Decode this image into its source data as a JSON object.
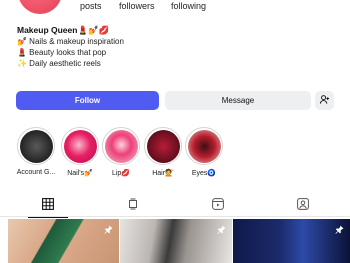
{
  "profile": {
    "stats": {
      "posts_label": "posts",
      "followers_label": "followers",
      "following_label": "following"
    },
    "bio": {
      "name": "Makeup Queen💄💅💋",
      "lines": [
        "💅 Nails & makeup inspiration",
        "💄 Beauty looks that pop",
        "✨ Daily aesthetic reels"
      ]
    },
    "actions": {
      "follow_label": "Follow",
      "message_label": "Message",
      "add_icon": "add-person-icon"
    }
  },
  "highlights": [
    {
      "label": "Account G...",
      "color": "#2a2a2a"
    },
    {
      "label": "Nail's💅",
      "color": "#c2185b"
    },
    {
      "label": "Lip💋",
      "color": "#d81b60"
    },
    {
      "label": "Hair💇",
      "color": "#7b1c2a"
    },
    {
      "label": "Eyes🧿",
      "color": "#8e1e2e"
    }
  ],
  "tabs": [
    {
      "name": "grid",
      "icon": "grid-icon",
      "active": true
    },
    {
      "name": "reels-saved",
      "icon": "stack-icon",
      "active": false
    },
    {
      "name": "reels",
      "icon": "reels-icon",
      "active": false
    },
    {
      "name": "tagged",
      "icon": "tagged-person-icon",
      "active": false
    }
  ],
  "grid_posts": [
    {
      "icon": "pin-icon",
      "color": "#1f5a3c"
    },
    {
      "icon": "pin-icon",
      "color": "#3a3a3a"
    },
    {
      "icon": "pin-icon",
      "color": "#1b2a6b"
    }
  ],
  "colors": {
    "accent": "#4f5bf1",
    "button_secondary": "#eeeff1"
  }
}
